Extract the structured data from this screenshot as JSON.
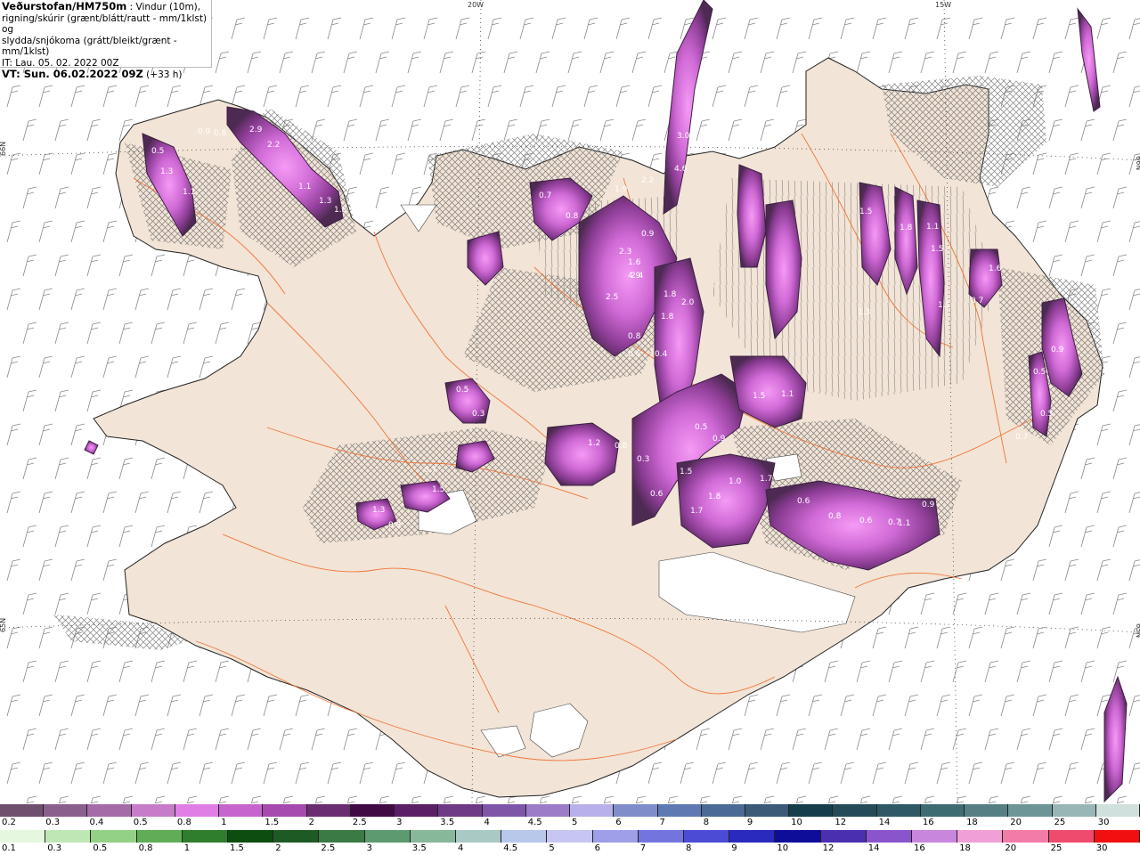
{
  "header": {
    "title": "Veðurstofan/HM750m",
    "title_rest": " : Vindur (10m),",
    "line2": "rigning/skúrir (grænt/blátt/rautt - mm/1klst) og",
    "line3": "slydda/snjókoma (grátt/bleikt/grænt - mm/1klst)",
    "issue_time": "IT: Lau. 05. 02. 2022 00Z",
    "valid_prefix": "VT: Sun. 06.02.2022 09Z",
    "valid_suffix": " (+33 h)"
  },
  "graticule": {
    "lon_labels": [
      "20W",
      "15W"
    ],
    "lat_labels": [
      "66N",
      "65N"
    ]
  },
  "precip_labels": [
    "0.9",
    "0.8",
    "2.9",
    "2.2",
    "0.5",
    "1.3",
    "1.1",
    "1.1",
    "1.3",
    "1.5",
    "0.7",
    "0.8",
    "3.0",
    "4.6",
    "2.2",
    "1.9",
    "0.9",
    "2.3",
    "1.6",
    "2.4",
    "4.9",
    "2.5",
    "1.8",
    "2.0",
    "1.8",
    "0.8",
    "0.6",
    "0.4",
    "1.2",
    "0.8",
    "0.3",
    "0.5",
    "0.3",
    "0.7",
    "1.5",
    "1.3",
    "0.8",
    "0.6",
    "1.5",
    "1.7",
    "1.5",
    "1.1",
    "1.0",
    "1.7",
    "1.8",
    "0.5",
    "0.9",
    "0.6",
    "0.8",
    "0.6",
    "0.7",
    "0.9",
    "1.1",
    "1.5",
    "1.8",
    "1.1",
    "1.5",
    "1.6",
    "0.7",
    "1.3",
    "1.1",
    "0.9",
    "0.5",
    "0.5",
    "0.7"
  ],
  "scale_snow": {
    "labels": [
      "0.2",
      "0.3",
      "0.4",
      "0.5",
      "0.8",
      "1",
      "1.5",
      "2",
      "2.5",
      "3",
      "3.5",
      "4",
      "4.5",
      "5",
      "6",
      "7",
      "8",
      "9",
      "10",
      "12",
      "14",
      "16",
      "18",
      "20",
      "25",
      "30"
    ],
    "colors": [
      "#6e4f6e",
      "#8a5f8e",
      "#a56aa8",
      "#c67cc8",
      "#e07ee6",
      "#c765cf",
      "#a64aaf",
      "#6a2d70",
      "#420a45",
      "#5a1f66",
      "#6f3a86",
      "#7e56a8",
      "#9c7cc9",
      "#b7b0ea",
      "#7f8ecb",
      "#5f7ab3",
      "#4c6a96",
      "#3b5b78",
      "#163d4a",
      "#244b57",
      "#2d5a64",
      "#3e6c72",
      "#567f84",
      "#6d9597",
      "#99b6b6",
      "#cfe0dd"
    ]
  },
  "scale_rain": {
    "labels": [
      "0.1",
      "0.3",
      "0.5",
      "0.8",
      "1",
      "1.5",
      "2",
      "2.5",
      "3",
      "3.5",
      "4",
      "4.5",
      "5",
      "6",
      "7",
      "8",
      "9",
      "10",
      "12",
      "14",
      "16",
      "18",
      "20",
      "25",
      "30"
    ],
    "colors": [
      "#e6f7e0",
      "#bfe7b5",
      "#93d186",
      "#5fae57",
      "#2f7e2d",
      "#0d4d10",
      "#1e5b24",
      "#3b7a45",
      "#5e9a6f",
      "#87b89a",
      "#a8c9c4",
      "#b7c8ea",
      "#c7c6f2",
      "#9e9fe8",
      "#7474de",
      "#4b4bd6",
      "#2a2abf",
      "#0d0d99",
      "#4a2fb0",
      "#8a55cc",
      "#c886dd",
      "#f0a0d6",
      "#f27ca7",
      "#ee4b6e",
      "#f01010"
    ]
  }
}
